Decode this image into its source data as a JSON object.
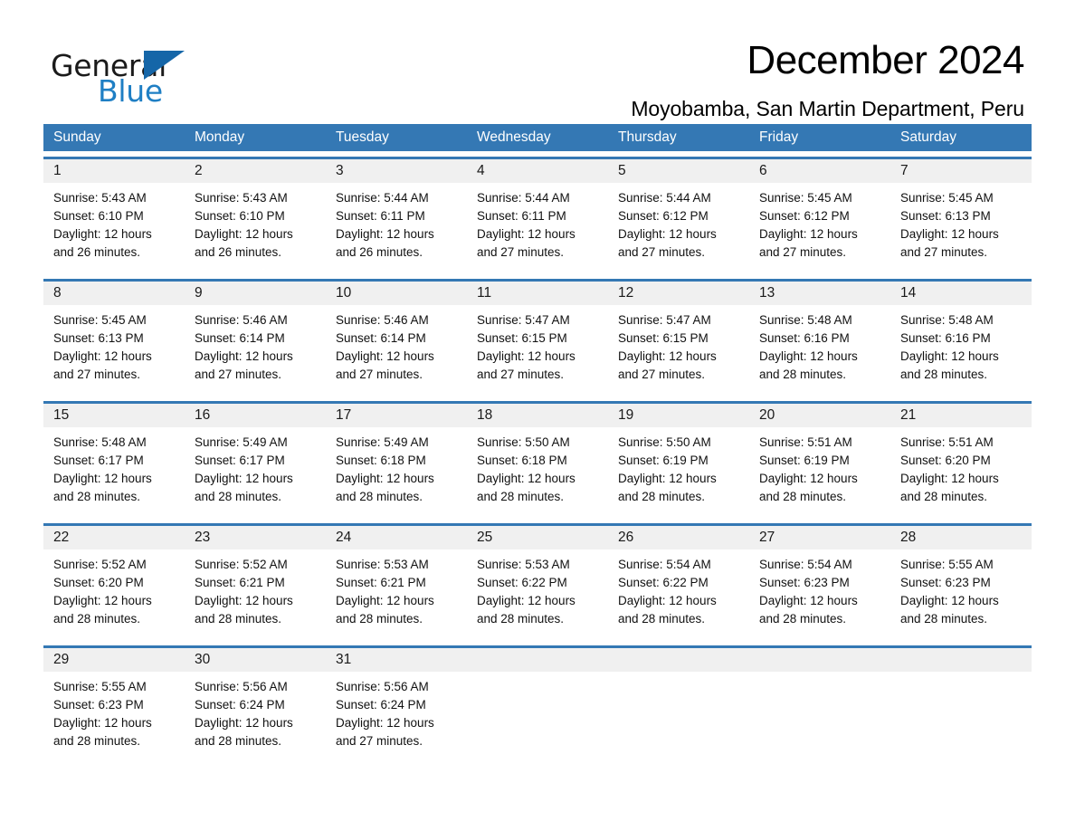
{
  "brand": {
    "name_part1": "General",
    "name_part2": "Blue",
    "triangle_color": "#1566a8",
    "blue_text_color": "#1f7fc4"
  },
  "header": {
    "title": "December 2024",
    "subtitle": "Moyobamba, San Martin Department, Peru"
  },
  "theme": {
    "header_blue": "#3478b4",
    "date_band_gray": "#f0f0f0",
    "page_bg": "#ffffff"
  },
  "calendar": {
    "day_headers": [
      "Sunday",
      "Monday",
      "Tuesday",
      "Wednesday",
      "Thursday",
      "Friday",
      "Saturday"
    ],
    "weeks": [
      [
        {
          "day": "1",
          "sunrise": "Sunrise: 5:43 AM",
          "sunset": "Sunset: 6:10 PM",
          "daylight_line1": "Daylight: 12 hours",
          "daylight_line2": "and 26 minutes."
        },
        {
          "day": "2",
          "sunrise": "Sunrise: 5:43 AM",
          "sunset": "Sunset: 6:10 PM",
          "daylight_line1": "Daylight: 12 hours",
          "daylight_line2": "and 26 minutes."
        },
        {
          "day": "3",
          "sunrise": "Sunrise: 5:44 AM",
          "sunset": "Sunset: 6:11 PM",
          "daylight_line1": "Daylight: 12 hours",
          "daylight_line2": "and 26 minutes."
        },
        {
          "day": "4",
          "sunrise": "Sunrise: 5:44 AM",
          "sunset": "Sunset: 6:11 PM",
          "daylight_line1": "Daylight: 12 hours",
          "daylight_line2": "and 27 minutes."
        },
        {
          "day": "5",
          "sunrise": "Sunrise: 5:44 AM",
          "sunset": "Sunset: 6:12 PM",
          "daylight_line1": "Daylight: 12 hours",
          "daylight_line2": "and 27 minutes."
        },
        {
          "day": "6",
          "sunrise": "Sunrise: 5:45 AM",
          "sunset": "Sunset: 6:12 PM",
          "daylight_line1": "Daylight: 12 hours",
          "daylight_line2": "and 27 minutes."
        },
        {
          "day": "7",
          "sunrise": "Sunrise: 5:45 AM",
          "sunset": "Sunset: 6:13 PM",
          "daylight_line1": "Daylight: 12 hours",
          "daylight_line2": "and 27 minutes."
        }
      ],
      [
        {
          "day": "8",
          "sunrise": "Sunrise: 5:45 AM",
          "sunset": "Sunset: 6:13 PM",
          "daylight_line1": "Daylight: 12 hours",
          "daylight_line2": "and 27 minutes."
        },
        {
          "day": "9",
          "sunrise": "Sunrise: 5:46 AM",
          "sunset": "Sunset: 6:14 PM",
          "daylight_line1": "Daylight: 12 hours",
          "daylight_line2": "and 27 minutes."
        },
        {
          "day": "10",
          "sunrise": "Sunrise: 5:46 AM",
          "sunset": "Sunset: 6:14 PM",
          "daylight_line1": "Daylight: 12 hours",
          "daylight_line2": "and 27 minutes."
        },
        {
          "day": "11",
          "sunrise": "Sunrise: 5:47 AM",
          "sunset": "Sunset: 6:15 PM",
          "daylight_line1": "Daylight: 12 hours",
          "daylight_line2": "and 27 minutes."
        },
        {
          "day": "12",
          "sunrise": "Sunrise: 5:47 AM",
          "sunset": "Sunset: 6:15 PM",
          "daylight_line1": "Daylight: 12 hours",
          "daylight_line2": "and 27 minutes."
        },
        {
          "day": "13",
          "sunrise": "Sunrise: 5:48 AM",
          "sunset": "Sunset: 6:16 PM",
          "daylight_line1": "Daylight: 12 hours",
          "daylight_line2": "and 28 minutes."
        },
        {
          "day": "14",
          "sunrise": "Sunrise: 5:48 AM",
          "sunset": "Sunset: 6:16 PM",
          "daylight_line1": "Daylight: 12 hours",
          "daylight_line2": "and 28 minutes."
        }
      ],
      [
        {
          "day": "15",
          "sunrise": "Sunrise: 5:48 AM",
          "sunset": "Sunset: 6:17 PM",
          "daylight_line1": "Daylight: 12 hours",
          "daylight_line2": "and 28 minutes."
        },
        {
          "day": "16",
          "sunrise": "Sunrise: 5:49 AM",
          "sunset": "Sunset: 6:17 PM",
          "daylight_line1": "Daylight: 12 hours",
          "daylight_line2": "and 28 minutes."
        },
        {
          "day": "17",
          "sunrise": "Sunrise: 5:49 AM",
          "sunset": "Sunset: 6:18 PM",
          "daylight_line1": "Daylight: 12 hours",
          "daylight_line2": "and 28 minutes."
        },
        {
          "day": "18",
          "sunrise": "Sunrise: 5:50 AM",
          "sunset": "Sunset: 6:18 PM",
          "daylight_line1": "Daylight: 12 hours",
          "daylight_line2": "and 28 minutes."
        },
        {
          "day": "19",
          "sunrise": "Sunrise: 5:50 AM",
          "sunset": "Sunset: 6:19 PM",
          "daylight_line1": "Daylight: 12 hours",
          "daylight_line2": "and 28 minutes."
        },
        {
          "day": "20",
          "sunrise": "Sunrise: 5:51 AM",
          "sunset": "Sunset: 6:19 PM",
          "daylight_line1": "Daylight: 12 hours",
          "daylight_line2": "and 28 minutes."
        },
        {
          "day": "21",
          "sunrise": "Sunrise: 5:51 AM",
          "sunset": "Sunset: 6:20 PM",
          "daylight_line1": "Daylight: 12 hours",
          "daylight_line2": "and 28 minutes."
        }
      ],
      [
        {
          "day": "22",
          "sunrise": "Sunrise: 5:52 AM",
          "sunset": "Sunset: 6:20 PM",
          "daylight_line1": "Daylight: 12 hours",
          "daylight_line2": "and 28 minutes."
        },
        {
          "day": "23",
          "sunrise": "Sunrise: 5:52 AM",
          "sunset": "Sunset: 6:21 PM",
          "daylight_line1": "Daylight: 12 hours",
          "daylight_line2": "and 28 minutes."
        },
        {
          "day": "24",
          "sunrise": "Sunrise: 5:53 AM",
          "sunset": "Sunset: 6:21 PM",
          "daylight_line1": "Daylight: 12 hours",
          "daylight_line2": "and 28 minutes."
        },
        {
          "day": "25",
          "sunrise": "Sunrise: 5:53 AM",
          "sunset": "Sunset: 6:22 PM",
          "daylight_line1": "Daylight: 12 hours",
          "daylight_line2": "and 28 minutes."
        },
        {
          "day": "26",
          "sunrise": "Sunrise: 5:54 AM",
          "sunset": "Sunset: 6:22 PM",
          "daylight_line1": "Daylight: 12 hours",
          "daylight_line2": "and 28 minutes."
        },
        {
          "day": "27",
          "sunrise": "Sunrise: 5:54 AM",
          "sunset": "Sunset: 6:23 PM",
          "daylight_line1": "Daylight: 12 hours",
          "daylight_line2": "and 28 minutes."
        },
        {
          "day": "28",
          "sunrise": "Sunrise: 5:55 AM",
          "sunset": "Sunset: 6:23 PM",
          "daylight_line1": "Daylight: 12 hours",
          "daylight_line2": "and 28 minutes."
        }
      ],
      [
        {
          "day": "29",
          "sunrise": "Sunrise: 5:55 AM",
          "sunset": "Sunset: 6:23 PM",
          "daylight_line1": "Daylight: 12 hours",
          "daylight_line2": "and 28 minutes."
        },
        {
          "day": "30",
          "sunrise": "Sunrise: 5:56 AM",
          "sunset": "Sunset: 6:24 PM",
          "daylight_line1": "Daylight: 12 hours",
          "daylight_line2": "and 28 minutes."
        },
        {
          "day": "31",
          "sunrise": "Sunrise: 5:56 AM",
          "sunset": "Sunset: 6:24 PM",
          "daylight_line1": "Daylight: 12 hours",
          "daylight_line2": "and 27 minutes."
        },
        {
          "day": "",
          "sunrise": "",
          "sunset": "",
          "daylight_line1": "",
          "daylight_line2": ""
        },
        {
          "day": "",
          "sunrise": "",
          "sunset": "",
          "daylight_line1": "",
          "daylight_line2": ""
        },
        {
          "day": "",
          "sunrise": "",
          "sunset": "",
          "daylight_line1": "",
          "daylight_line2": ""
        },
        {
          "day": "",
          "sunrise": "",
          "sunset": "",
          "daylight_line1": "",
          "daylight_line2": ""
        }
      ]
    ]
  }
}
